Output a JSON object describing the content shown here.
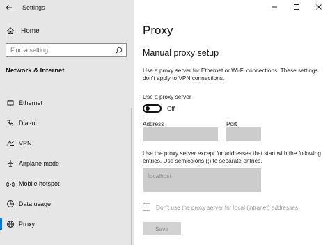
{
  "window": {
    "app_title": "Settings"
  },
  "sidebar": {
    "home_label": "Home",
    "search_placeholder": "Find a setting",
    "section_title": "Network & Internet",
    "items": [
      {
        "label": "Ethernet",
        "icon": "ethernet-icon"
      },
      {
        "label": "Dial-up",
        "icon": "dialup-icon"
      },
      {
        "label": "VPN",
        "icon": "vpn-icon"
      },
      {
        "label": "Airplane mode",
        "icon": "airplane-icon"
      },
      {
        "label": "Mobile hotspot",
        "icon": "hotspot-icon"
      },
      {
        "label": "Data usage",
        "icon": "data-usage-icon"
      },
      {
        "label": "Proxy",
        "icon": "globe-icon",
        "selected": true
      }
    ]
  },
  "main": {
    "page_title": "Proxy",
    "section_title": "Manual proxy setup",
    "description": "Use a proxy server for Ethernet or Wi-Fi connections. These settings don't apply to VPN connections.",
    "use_proxy_label": "Use a proxy server",
    "toggle_state": "Off",
    "toggle_on": false,
    "address_label": "Address",
    "address_value": "",
    "port_label": "Port",
    "port_value": "",
    "exceptions_description": "Use the proxy server except for addresses that start with the following entries. Use semicolons (;) to separate entries.",
    "exceptions_value": "localhost",
    "local_bypass_label": "Don't use the proxy server for local (intranet) addresses",
    "local_bypass_checked": false,
    "save_label": "Save"
  },
  "colors": {
    "accent": "#0078d7",
    "sidebar_bg": "#e6e6e6",
    "disabled_field": "#cccccc"
  }
}
